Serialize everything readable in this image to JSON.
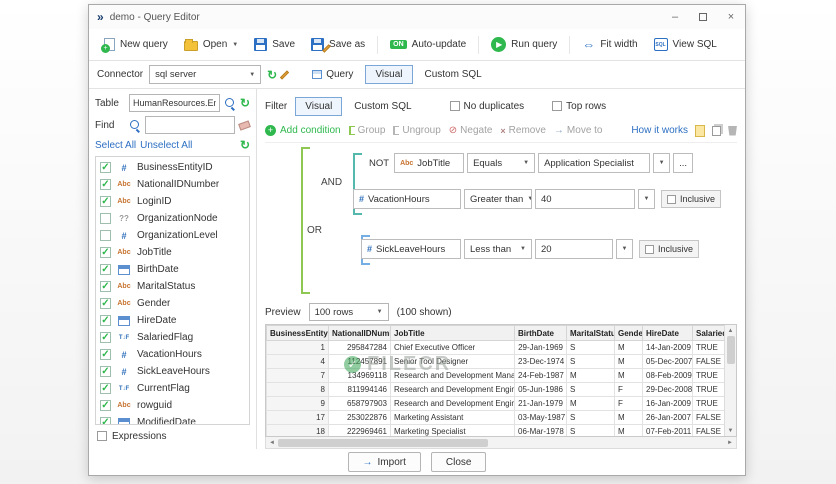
{
  "window": {
    "title": "demo - Query Editor"
  },
  "icons": {
    "app_chevrons": "»",
    "minimize": "–",
    "close": "×",
    "dropdown": "▼",
    "run_play": "▶",
    "fit_arrows": "⇔",
    "refresh": "↻",
    "check": "✓",
    "add_plus": "+",
    "negate": "⊘",
    "remove_x": "×",
    "move_arrow": "→",
    "import_arrow": "→",
    "up": "▲",
    "down": "▼",
    "left": "◄",
    "right": "►",
    "on_badge": "ON",
    "sql_badge": "SQL",
    "ellipsis": "..."
  },
  "toolbar": {
    "new_query": "New query",
    "open": "Open",
    "save": "Save",
    "save_as": "Save as",
    "auto_update": "Auto-update",
    "run_query": "Run query",
    "fit_width": "Fit width",
    "view_sql": "View SQL"
  },
  "connector": {
    "label": "Connector",
    "value": "sql server"
  },
  "query_tabs": {
    "query": "Query",
    "visual": "Visual",
    "custom_sql": "Custom SQL"
  },
  "left_panel": {
    "table_label": "Table",
    "table_value": "HumanResources.Emp",
    "find_label": "Find",
    "find_value": "",
    "select_all": "Select All",
    "unselect_all": "Unselect All",
    "expressions_label": "Expressions",
    "fields": [
      {
        "label": "BusinessEntityID",
        "type": "number",
        "glyph": "#",
        "checked": true
      },
      {
        "label": "NationalIDNumber",
        "type": "text",
        "glyph": "Abc",
        "checked": true
      },
      {
        "label": "LoginID",
        "type": "text",
        "glyph": "Abc",
        "checked": true
      },
      {
        "label": "OrganizationNode",
        "type": "unknown",
        "glyph": "??",
        "checked": false
      },
      {
        "label": "OrganizationLevel",
        "type": "number",
        "glyph": "#",
        "checked": false
      },
      {
        "label": "JobTitle",
        "type": "text",
        "glyph": "Abc",
        "checked": true
      },
      {
        "label": "BirthDate",
        "type": "date",
        "glyph": "",
        "checked": true
      },
      {
        "label": "MaritalStatus",
        "type": "text",
        "glyph": "Abc",
        "checked": true
      },
      {
        "label": "Gender",
        "type": "text",
        "glyph": "Abc",
        "checked": true
      },
      {
        "label": "HireDate",
        "type": "date",
        "glyph": "",
        "checked": true
      },
      {
        "label": "SalariedFlag",
        "type": "bool",
        "glyph": "T↓F",
        "checked": true
      },
      {
        "label": "VacationHours",
        "type": "number",
        "glyph": "#",
        "checked": true
      },
      {
        "label": "SickLeaveHours",
        "type": "number",
        "glyph": "#",
        "checked": true
      },
      {
        "label": "CurrentFlag",
        "type": "bool",
        "glyph": "T↓F",
        "checked": true
      },
      {
        "label": "rowguid",
        "type": "text",
        "glyph": "Abc",
        "checked": true
      },
      {
        "label": "ModifiedDate",
        "type": "date",
        "glyph": "",
        "checked": true
      }
    ]
  },
  "filter": {
    "label": "Filter",
    "tab_visual": "Visual",
    "tab_custom": "Custom SQL",
    "no_duplicates": "No duplicates",
    "top_rows": "Top rows",
    "add_condition": "Add condition",
    "group": "Group",
    "ungroup": "Ungroup",
    "negate": "Negate",
    "remove": "Remove",
    "move_to": "Move to",
    "how_it_works": "How it works"
  },
  "conditions": {
    "root_op": "OR",
    "group_op": "AND",
    "not_label": "NOT",
    "rows": [
      {
        "field": "JobTitle",
        "glyph": "Abc",
        "op": "Equals",
        "value": "Application Specialist"
      },
      {
        "field": "VacationHours",
        "glyph": "#",
        "op": "Greater than",
        "value": "40",
        "inclusive": "Inclusive"
      },
      {
        "field": "SickLeaveHours",
        "glyph": "#",
        "op": "Less than",
        "value": "20",
        "inclusive": "Inclusive"
      }
    ]
  },
  "preview": {
    "label": "Preview",
    "rows_value": "100 rows",
    "shown": "(100 shown)"
  },
  "grid": {
    "columns": [
      "BusinessEntityID",
      "NationalIDNumber",
      "JobTitle",
      "BirthDate",
      "MaritalStatus",
      "Gender",
      "HireDate",
      "SalariedFla"
    ],
    "rows": [
      [
        "1",
        "295847284",
        "Chief Executive Officer",
        "29-Jan-1969",
        "S",
        "M",
        "14-Jan-2009",
        "TRUE"
      ],
      [
        "4",
        "112457891",
        "Senior Tool Designer",
        "23-Dec-1974",
        "S",
        "M",
        "05-Dec-2007",
        "FALSE"
      ],
      [
        "7",
        "134969118",
        "Research and Development Manager",
        "24-Feb-1987",
        "M",
        "M",
        "08-Feb-2009",
        "TRUE"
      ],
      [
        "8",
        "811994146",
        "Research and Development Engineer",
        "05-Jun-1986",
        "S",
        "F",
        "29-Dec-2008",
        "TRUE"
      ],
      [
        "9",
        "658797903",
        "Research and Development Engineer",
        "21-Jan-1979",
        "M",
        "F",
        "16-Jan-2009",
        "TRUE"
      ],
      [
        "17",
        "253022876",
        "Marketing Assistant",
        "03-May-1987",
        "S",
        "M",
        "26-Jan-2007",
        "FALSE"
      ],
      [
        "18",
        "222969461",
        "Marketing Specialist",
        "06-Mar-1978",
        "S",
        "M",
        "07-Feb-2011",
        "FALSE"
      ]
    ]
  },
  "watermark": {
    "text": "FILECR",
    "logo_glyph": "✓"
  },
  "footer": {
    "import": "Import",
    "close": "Close"
  }
}
